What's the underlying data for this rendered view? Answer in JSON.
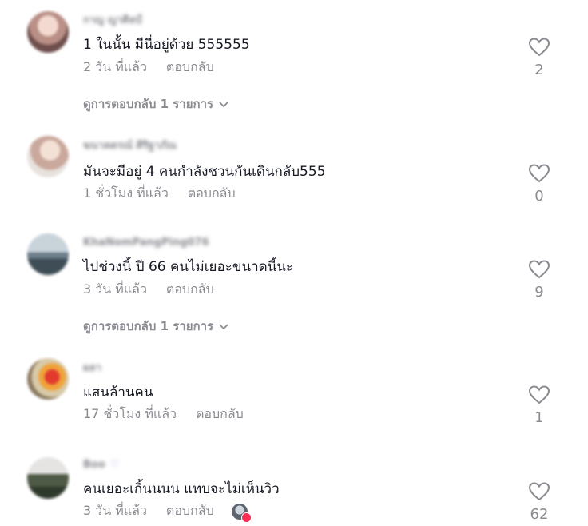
{
  "comments": [
    {
      "username": "กาญ ญาศิลป์",
      "text": "1 ในนั้น มีนี่อยู่ด้วย 555555",
      "time": "2 วัน ที่แล้ว",
      "reply_label": "ตอบกลับ",
      "likes": "2",
      "view_replies": "ดูการตอบกลับ 1 รายการ"
    },
    {
      "username": "ฆนาคตรณ์ ศิริฐาภัณ",
      "text": "มันจะมีอยู่ 4 คนกำลังชวนกันเดินกลับ555",
      "time": "1 ชั่วโมง ที่แล้ว",
      "reply_label": "ตอบกลับ",
      "likes": "0"
    },
    {
      "username": "KhaNomPangPing076",
      "text": "ไปช่วงนี้ ปี 66 คนไม่เยอะขนาดนี้นะ",
      "time": "3 วัน ที่แล้ว",
      "reply_label": "ตอบกลับ",
      "likes": "9",
      "view_replies": "ดูการตอบกลับ 1 รายการ"
    },
    {
      "username": "ผลา",
      "text": "แสนล้านคน",
      "time": "17 ชั่วโมง ที่แล้ว",
      "reply_label": "ตอบกลับ",
      "likes": "1"
    },
    {
      "username": "Boo",
      "username_badge": "♡",
      "text": "คนเยอะเกิ้นนนน แทบจะไม่เห็นวิว",
      "time": "3 วัน ที่แล้ว",
      "reply_label": "ตอบกลับ",
      "likes": "62",
      "creator_liked": true
    }
  ],
  "colors": {
    "text": "#161823",
    "secondary": "#8a8b91",
    "liked_badge": "#fe2c55"
  },
  "icons": {
    "like": "heart-outline-icon",
    "expand": "chevron-down-icon"
  }
}
